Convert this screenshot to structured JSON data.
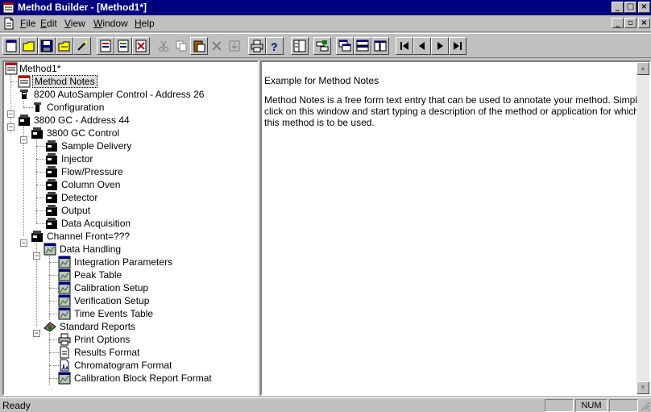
{
  "window": {
    "title": "Method Builder - [Method1*]"
  },
  "menu": {
    "items": [
      {
        "label": "File",
        "mnemonic": "F"
      },
      {
        "label": "Edit",
        "mnemonic": "E"
      },
      {
        "label": "View",
        "mnemonic": "V"
      },
      {
        "label": "Window",
        "mnemonic": "W"
      },
      {
        "label": "Help",
        "mnemonic": "H"
      }
    ]
  },
  "tree": {
    "root": "Method1*",
    "method_notes": "Method Notes",
    "autosampler": "8200 AutoSampler Control - Address 26",
    "configuration": "Configuration",
    "gc": "3800 GC - Address 44",
    "gc_control": "3800 GC Control",
    "sample_delivery": "Sample Delivery",
    "injector": "Injector",
    "flow_pressure": "Flow/Pressure",
    "column_oven": "Column Oven",
    "detector": "Detector",
    "output": "Output",
    "data_acquisition": "Data Acquisition",
    "channel_front": "Channel Front=???",
    "data_handling": "Data Handling",
    "integration_parameters": "Integration Parameters",
    "peak_table": "Peak Table",
    "calibration_setup": "Calibration Setup",
    "verification_setup": "Verification Setup",
    "time_events_table": "Time Events Table",
    "standard_reports": "Standard Reports",
    "print_options": "Print Options",
    "results_format": "Results Format",
    "chromatogram_format": "Chromatogram Format",
    "calibration_block_report_format": "Calibration Block Report Format"
  },
  "notes": {
    "heading": "Example for Method Notes",
    "body": "Method Notes is a free form text entry that can be used to annotate your method. Simply click on this window and start typing a description of the method or application for which this method is to be used."
  },
  "status": {
    "text": "Ready",
    "num": "NUM"
  },
  "colors": {
    "titlebar": "#000080",
    "face": "#c0c0c0",
    "selection": "#e0e0e0"
  }
}
